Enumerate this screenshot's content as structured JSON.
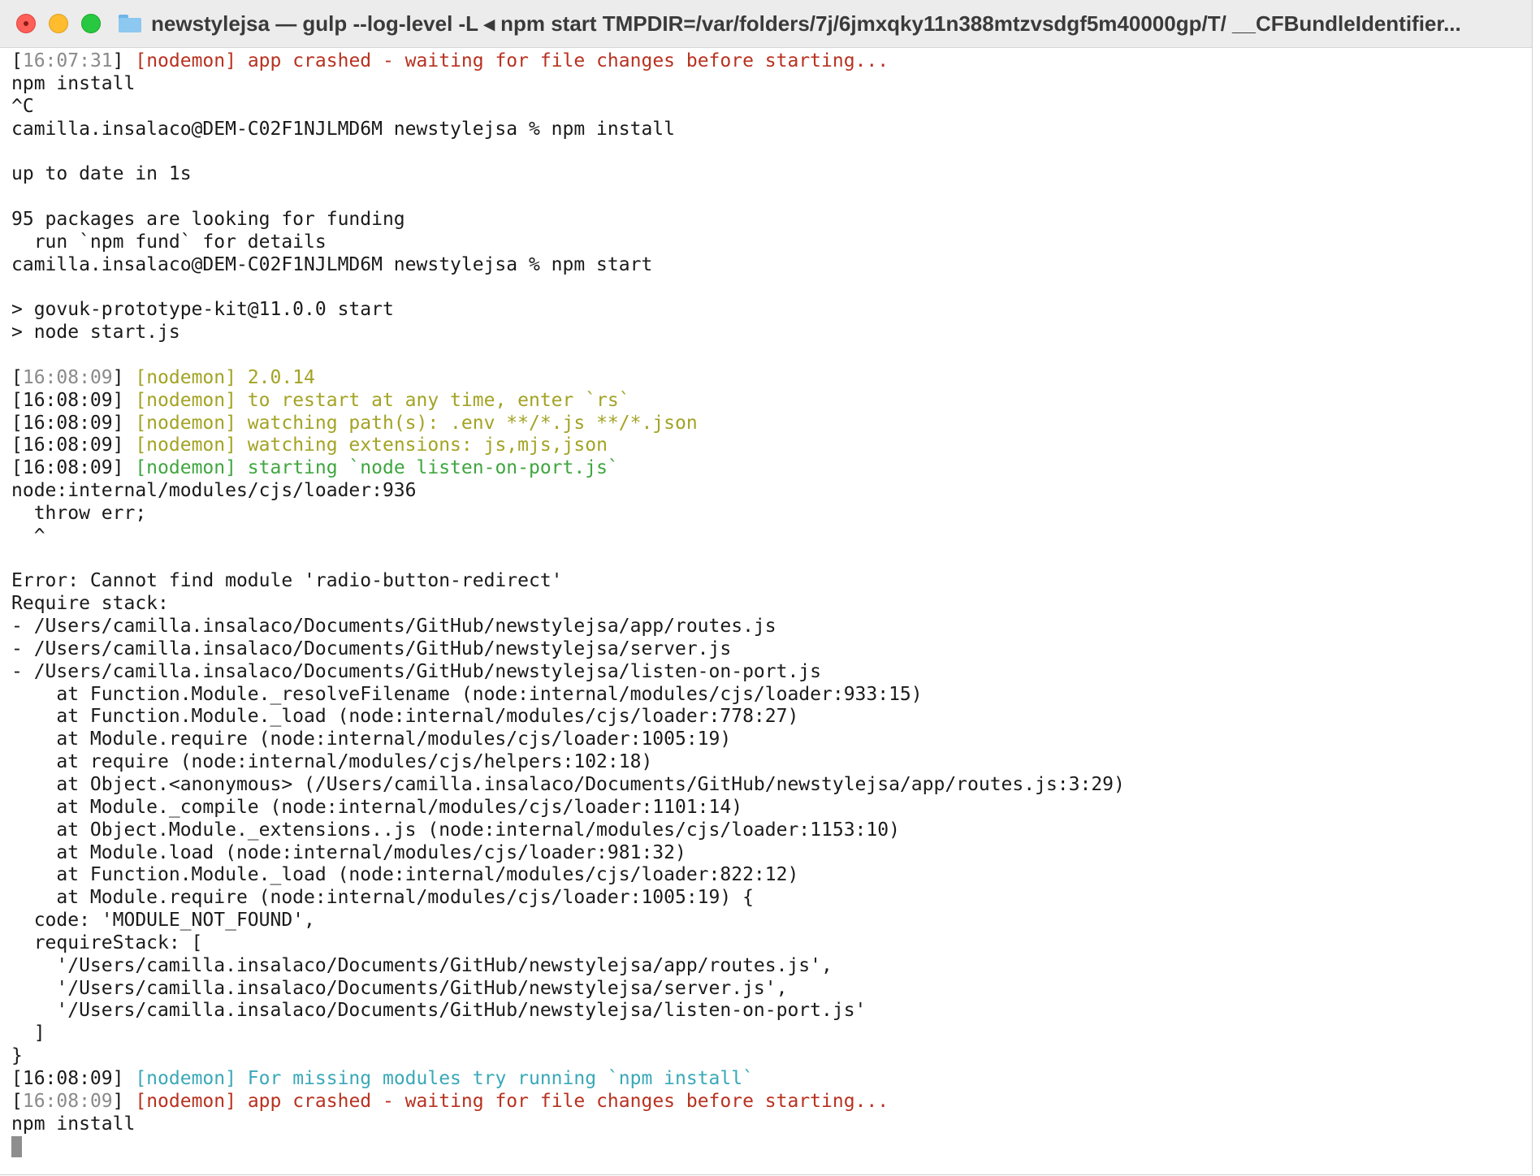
{
  "window": {
    "title": "newstylejsa — gulp --log-level -L ◂ npm start TMPDIR=/var/folders/7j/6jmxqky11n388mtzvsdgf5m40000gp/T/ __CFBundleIdentifier...",
    "colors": {
      "background": "#ffffff",
      "text": "#1a1a1a",
      "red": "#b8311f",
      "yellow": "#a3a325",
      "green": "#3fa63f",
      "cyan": "#3aa8b8",
      "timestamp_dim": "#8a8a8a"
    }
  },
  "terminal": {
    "lines": [
      {
        "ts": "[16:07:31]",
        "dimts": true,
        "text": " [nodemon] app crashed - waiting for file changes before starting...",
        "color": "red"
      },
      {
        "text": "npm install"
      },
      {
        "text": "^C"
      },
      {
        "text": "camilla.insalaco@DEM-C02F1NJLMD6M newstylejsa % npm install"
      },
      {
        "text": ""
      },
      {
        "text": "up to date in 1s"
      },
      {
        "text": ""
      },
      {
        "text": "95 packages are looking for funding"
      },
      {
        "text": "  run `npm fund` for details"
      },
      {
        "text": "camilla.insalaco@DEM-C02F1NJLMD6M newstylejsa % npm start"
      },
      {
        "text": ""
      },
      {
        "text": "> govuk-prototype-kit@11.0.0 start"
      },
      {
        "text": "> node start.js"
      },
      {
        "text": ""
      },
      {
        "ts": "[16:08:09]",
        "dimts": true,
        "text": " [nodemon] 2.0.14",
        "color": "yellow"
      },
      {
        "ts": "[16:08:09]",
        "dimts": false,
        "text": " [nodemon] to restart at any time, enter `rs`",
        "color": "yellow"
      },
      {
        "ts": "[16:08:09]",
        "dimts": false,
        "text": " [nodemon] watching path(s): .env **/*.js **/*.json",
        "color": "yellow"
      },
      {
        "ts": "[16:08:09]",
        "dimts": false,
        "text": " [nodemon] watching extensions: js,mjs,json",
        "color": "yellow"
      },
      {
        "ts": "[16:08:09]",
        "dimts": false,
        "text": " [nodemon] starting `node listen-on-port.js`",
        "color": "green"
      },
      {
        "text": "node:internal/modules/cjs/loader:936"
      },
      {
        "text": "  throw err;"
      },
      {
        "text": "  ^"
      },
      {
        "text": ""
      },
      {
        "text": "Error: Cannot find module 'radio-button-redirect'"
      },
      {
        "text": "Require stack:"
      },
      {
        "text": "- /Users/camilla.insalaco/Documents/GitHub/newstylejsa/app/routes.js"
      },
      {
        "text": "- /Users/camilla.insalaco/Documents/GitHub/newstylejsa/server.js"
      },
      {
        "text": "- /Users/camilla.insalaco/Documents/GitHub/newstylejsa/listen-on-port.js"
      },
      {
        "text": "    at Function.Module._resolveFilename (node:internal/modules/cjs/loader:933:15)"
      },
      {
        "text": "    at Function.Module._load (node:internal/modules/cjs/loader:778:27)"
      },
      {
        "text": "    at Module.require (node:internal/modules/cjs/loader:1005:19)"
      },
      {
        "text": "    at require (node:internal/modules/cjs/helpers:102:18)"
      },
      {
        "text": "    at Object.<anonymous> (/Users/camilla.insalaco/Documents/GitHub/newstylejsa/app/routes.js:3:29)"
      },
      {
        "text": "    at Module._compile (node:internal/modules/cjs/loader:1101:14)"
      },
      {
        "text": "    at Object.Module._extensions..js (node:internal/modules/cjs/loader:1153:10)"
      },
      {
        "text": "    at Module.load (node:internal/modules/cjs/loader:981:32)"
      },
      {
        "text": "    at Function.Module._load (node:internal/modules/cjs/loader:822:12)"
      },
      {
        "text": "    at Module.require (node:internal/modules/cjs/loader:1005:19) {"
      },
      {
        "text": "  code: 'MODULE_NOT_FOUND',"
      },
      {
        "text": "  requireStack: ["
      },
      {
        "text": "    '/Users/camilla.insalaco/Documents/GitHub/newstylejsa/app/routes.js',"
      },
      {
        "text": "    '/Users/camilla.insalaco/Documents/GitHub/newstylejsa/server.js',"
      },
      {
        "text": "    '/Users/camilla.insalaco/Documents/GitHub/newstylejsa/listen-on-port.js'"
      },
      {
        "text": "  ]"
      },
      {
        "text": "}"
      },
      {
        "ts": "[16:08:09]",
        "dimts": false,
        "text": " [nodemon] For missing modules try running `npm install`",
        "color": "cyan"
      },
      {
        "ts": "[16:08:09]",
        "dimts": true,
        "text": " [nodemon] app crashed - waiting for file changes before starting...",
        "color": "red"
      },
      {
        "text": "npm install"
      }
    ]
  }
}
